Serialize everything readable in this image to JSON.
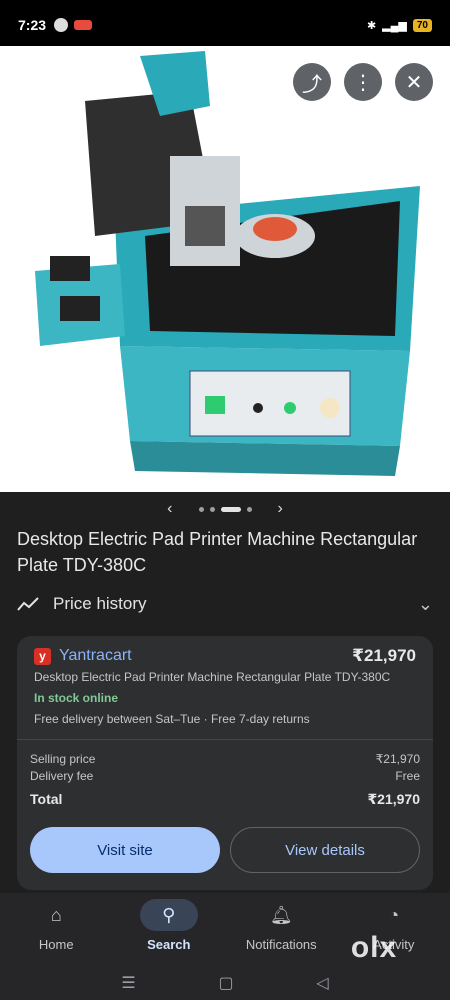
{
  "status": {
    "time": "7:23",
    "battery": "70"
  },
  "hero_actions": {
    "share": "share-icon",
    "more": "more-vert-icon",
    "close": "close-icon"
  },
  "carousel": {
    "prev": "‹",
    "next": "›"
  },
  "product": {
    "title": "Desktop Electric Pad Printer Machine Rectangular Plate TDY-380C"
  },
  "price_history": {
    "label": "Price history"
  },
  "offer": {
    "seller": "Yantracart",
    "price": "₹21,970",
    "description": "Desktop Electric Pad Printer Machine Rectangular Plate TDY-380C",
    "stock": "In stock online",
    "delivery": "Free delivery between Sat–Tue · Free 7-day returns",
    "selling_price_label": "Selling price",
    "selling_price_value": "₹21,970",
    "delivery_fee_label": "Delivery fee",
    "delivery_fee_value": "Free",
    "total_label": "Total",
    "total_value": "₹21,970",
    "visit_label": "Visit site",
    "details_label": "View details"
  },
  "nav": {
    "items": [
      {
        "label": "Home",
        "icon": "home-icon"
      },
      {
        "label": "Search",
        "icon": "search-icon"
      },
      {
        "label": "Notifications",
        "icon": "bell-icon"
      },
      {
        "label": "Activity",
        "icon": "activity-icon"
      }
    ]
  },
  "watermark": "olx"
}
